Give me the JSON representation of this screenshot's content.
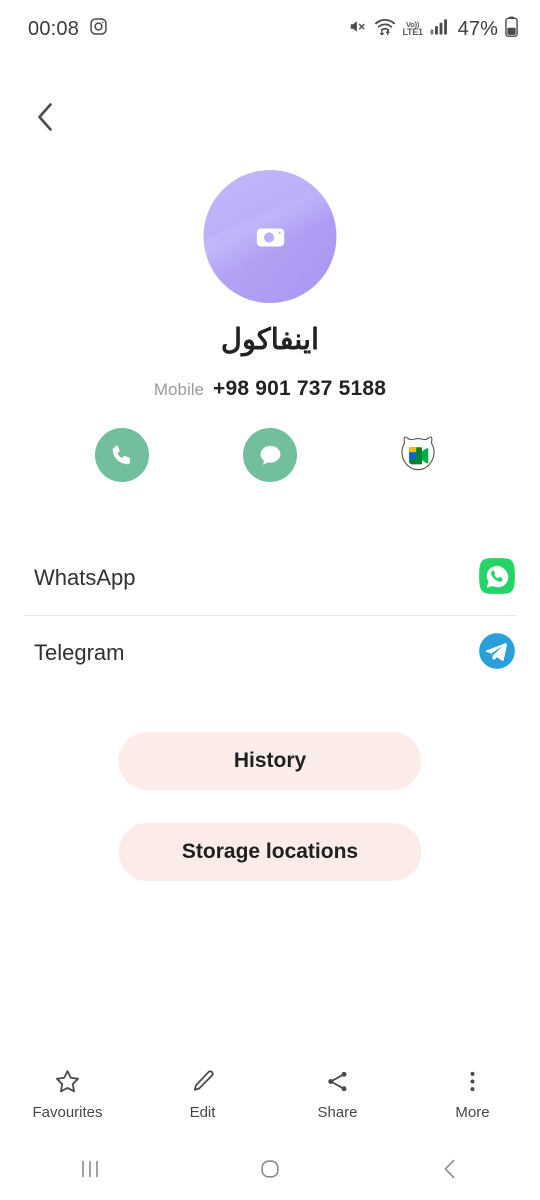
{
  "status_bar": {
    "time": "00:08",
    "icons_left": [
      "instagram-icon"
    ],
    "icons_right": [
      "mute-icon",
      "wifi-icon",
      "volte-icon",
      "signal-icon"
    ],
    "volte_top": "Vo))",
    "volte_bottom": "LTE1",
    "battery_percent": "47%"
  },
  "header": {
    "back_icon": "chevron-left-icon"
  },
  "contact": {
    "avatar_icon": "camera-icon",
    "avatar_color": "#b9aefa",
    "name": "اینفاکول",
    "phone_label": "Mobile",
    "phone_number": "+98 901 737 5188"
  },
  "quick_actions": [
    {
      "name": "call",
      "icon": "phone-icon",
      "color": "#71bf9c"
    },
    {
      "name": "message",
      "icon": "message-bubble-icon",
      "color": "#71bf9c"
    },
    {
      "name": "video-call",
      "icon": "google-meet-icon",
      "color": "#ffffff"
    }
  ],
  "app_rows": [
    {
      "label": "WhatsApp",
      "icon": "whatsapp-icon",
      "color": "#25d366"
    },
    {
      "label": "Telegram",
      "icon": "telegram-icon",
      "color": "#29a0da"
    }
  ],
  "pill_buttons": [
    {
      "label": "History",
      "color": "#fbece9"
    },
    {
      "label": "Storage locations",
      "color": "#fbece9"
    }
  ],
  "toolbar": [
    {
      "label": "Favourites",
      "icon": "star-outline-icon"
    },
    {
      "label": "Edit",
      "icon": "pencil-icon"
    },
    {
      "label": "Share",
      "icon": "share-nodes-icon"
    },
    {
      "label": "More",
      "icon": "more-vertical-icon"
    }
  ],
  "navbar": [
    {
      "name": "recents",
      "icon": "recents-bars-icon"
    },
    {
      "name": "home",
      "icon": "home-square-icon"
    },
    {
      "name": "back",
      "icon": "chevron-left-icon"
    }
  ]
}
